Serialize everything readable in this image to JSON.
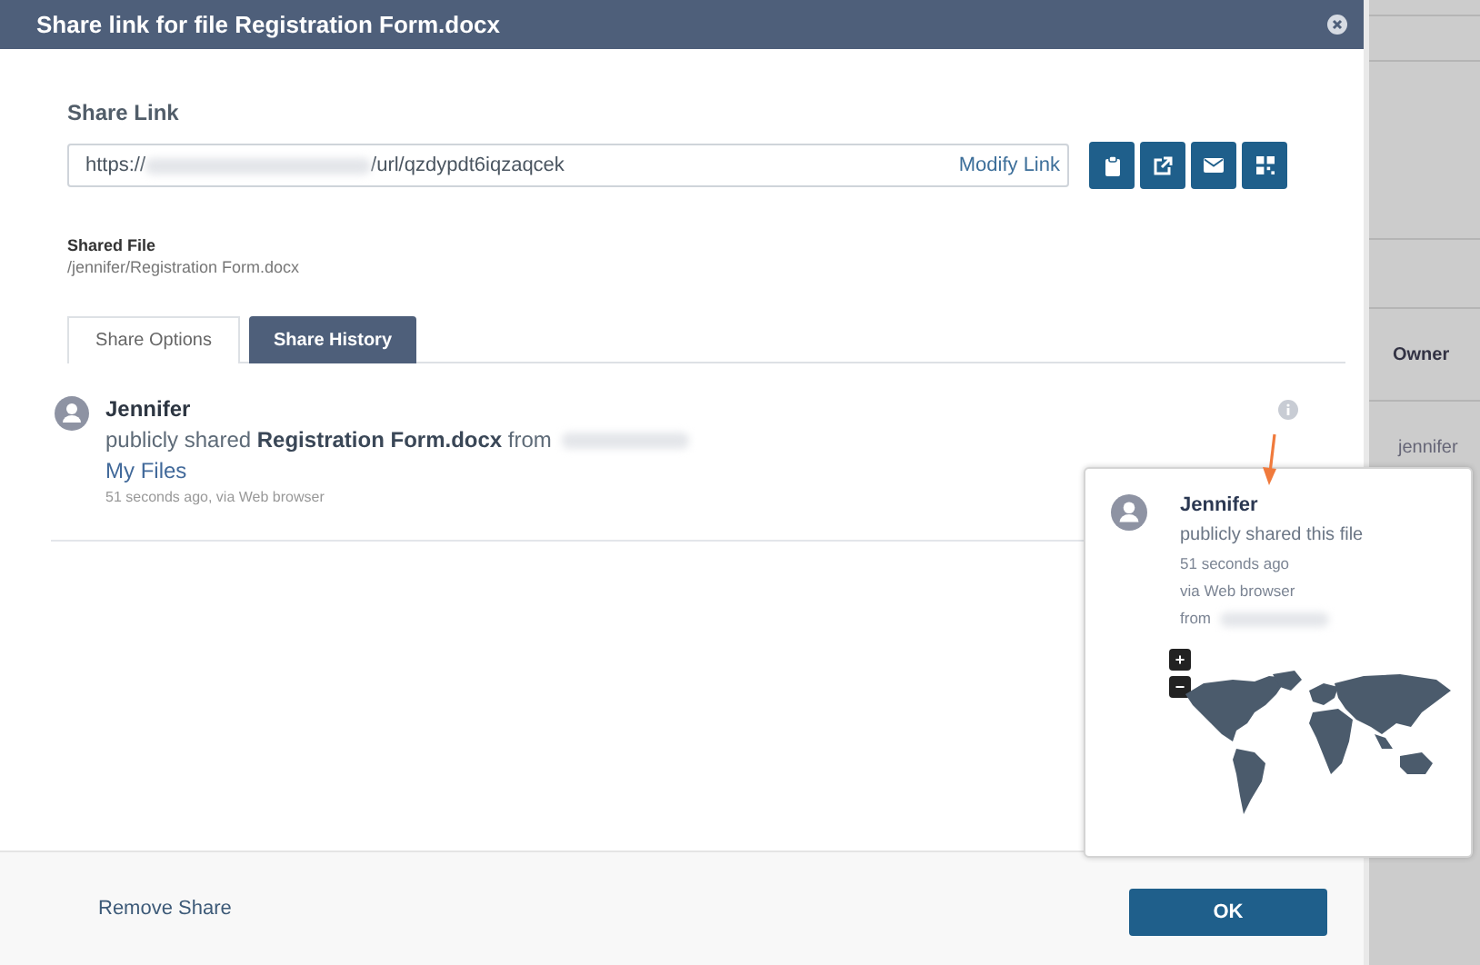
{
  "dialog": {
    "title": "Share link for file Registration Form.docx"
  },
  "share_link": {
    "label": "Share Link",
    "url_prefix": "https://",
    "url_suffix": "/url/qzdypdt6iqzaqcek",
    "modify_link": "Modify Link"
  },
  "action_buttons": [
    {
      "kind": "clipboard"
    },
    {
      "kind": "external"
    },
    {
      "kind": "email"
    },
    {
      "kind": "qr"
    }
  ],
  "shared_file": {
    "label": "Shared File",
    "path": "/jennifer/Registration Form.docx"
  },
  "tabs": [
    {
      "label": "Share Options",
      "selected": false
    },
    {
      "label": "Share History",
      "selected": true
    }
  ],
  "history": [
    {
      "user": "Jennifer",
      "action": "publicly shared **Registration Form.docx** from",
      "location": "My Files",
      "meta": "51 seconds ago, via Web browser"
    }
  ],
  "popup": {
    "user": "Jennifer",
    "action": "publicly shared this file",
    "time": "51 seconds ago",
    "via": "via Web browser",
    "from": "from",
    "zoom_in": "+",
    "zoom_out": "−"
  },
  "footer": {
    "remove": "Remove Share",
    "ok": "OK"
  },
  "background_table": {
    "header": "Owner",
    "cell": "jennifer"
  }
}
